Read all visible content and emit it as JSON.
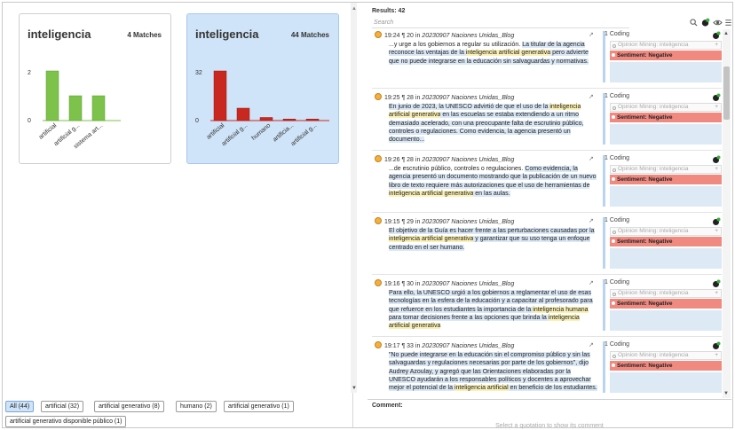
{
  "charts": [
    {
      "title": "inteligencia",
      "matches": "4 Matches",
      "selected": false,
      "color": "#7dc24b",
      "edge": "#5a9e32",
      "yticks": [
        "2",
        "0"
      ],
      "chart_data": {
        "type": "bar",
        "categories": [
          "artificial",
          "artificial g...",
          "sistema art..."
        ],
        "values": [
          2,
          1,
          1
        ],
        "ylim": [
          0,
          2
        ]
      }
    },
    {
      "title": "inteligencia",
      "matches": "44 Matches",
      "selected": true,
      "color": "#c8281f",
      "edge": "#9c1a13",
      "yticks": [
        "32",
        "0"
      ],
      "chart_data": {
        "type": "bar",
        "categories": [
          "artificial",
          "artificial g...",
          "humano",
          "artificia...",
          "artificial g..."
        ],
        "values": [
          32,
          8,
          2,
          1,
          1
        ],
        "ylim": [
          0,
          32
        ]
      }
    }
  ],
  "filters": [
    "All (44)",
    "artificial (32)",
    "artificial generativo (8)",
    "humano (2)",
    "artificial  generativo (1)",
    "artificial generativo disponible público (1)"
  ],
  "results": {
    "label": "Results: 42",
    "search_placeholder": "Search"
  },
  "items": [
    {
      "time": "19:24",
      "pilcrow": "¶ 20 in",
      "doc": "20230907 Naciones Unidas_Blog",
      "segments": [
        [
          "...y urge a los gobiernos a regular su utilización. ",
          ""
        ],
        [
          "La titular de la agencia reconoce las ventajas de la ",
          "hl2"
        ],
        [
          "inteligencia artificial generativa",
          "hl"
        ],
        [
          " pero advierte que no puede integrarse en la educación sin salvaguardas y normativas.",
          "hl2"
        ]
      ],
      "coding": "1 Coding",
      "code1": "Opinion Mining: inteligencia",
      "code2": "Sentiment: Negative"
    },
    {
      "time": "19:25",
      "pilcrow": "¶ 28 in",
      "doc": "20230907 Naciones Unidas_Blog",
      "segments": [
        [
          "En junio de 2023, la UNESCO advirtió de que el uso de la ",
          "hl2"
        ],
        [
          "inteligencia artificial generativa",
          "hl"
        ],
        [
          " en las escuelas se estaba extendiendo a un ritmo demasiado acelerado, con una preocupante falta de escrutinio público, controles o regulaciones. Como evidencia, la agencia presentó un documento...",
          "hl2"
        ]
      ],
      "coding": "1 Coding",
      "code1": "Opinion Mining: inteligencia",
      "code2": "Sentiment: Negative"
    },
    {
      "time": "19:26",
      "pilcrow": "¶ 28 in",
      "doc": "20230907 Naciones Unidas_Blog",
      "segments": [
        [
          "...de escrutinio público, controles o regulaciones. ",
          ""
        ],
        [
          "Como evidencia, la agencia presentó un documento mostrando que la publicación de un nuevo libro de texto requiere más autorizaciones que el uso de herramientas de ",
          "hl2"
        ],
        [
          "inteligencia artificial generativa",
          "hl"
        ],
        [
          " en las aulas.",
          "hl2"
        ]
      ],
      "coding": "1 Coding",
      "code1": "Opinion Mining: inteligencia",
      "code2": "Sentiment: Negative"
    },
    {
      "time": "19:15",
      "pilcrow": "¶ 29 in",
      "doc": "20230907 Naciones Unidas_Blog",
      "segments": [
        [
          "El objetivo de la Guía es hacer frente a las perturbaciones causadas por la ",
          "hl2"
        ],
        [
          "inteligencia artificial generativa",
          "hl"
        ],
        [
          " y garantizar que su uso tenga un enfoque centrado en el ser humano.",
          "hl2"
        ]
      ],
      "coding": "1 Coding",
      "code1": "Opinion Mining: inteligencia",
      "code2": "Sentiment: Negative"
    },
    {
      "time": "19:16",
      "pilcrow": "¶ 30 in",
      "doc": "20230907 Naciones Unidas_Blog",
      "segments": [
        [
          "Para ello, la UNESCO urgió a los gobiernos a reglamentar el uso de esas tecnologías en la esfera de la educación y a capacitar al profesorado para que refuerce en los estudiantes la importancia de la ",
          "hl2"
        ],
        [
          "inteligencia humana",
          "hl"
        ],
        [
          " para tomar decisiones frente a las opciones que brinda la ",
          "hl2"
        ],
        [
          "inteligencia artificial generativa",
          "hl"
        ]
      ],
      "coding": "1 Coding",
      "code1": "Opinion Mining: inteligencia",
      "code2": "Sentiment: Negative"
    },
    {
      "time": "19:17",
      "pilcrow": "¶ 33 in",
      "doc": "20230907 Naciones Unidas_Blog",
      "segments": [
        [
          "\"No puede integrarse en la educación sin el compromiso público y sin las salvaguardas y regulaciones necesarias por parte de los gobiernos\", dijo Audrey Azoulay, y agregó que las Orientaciones elaboradas por la UNESCO ayudarán a los responsables políticos y docentes a aprovechar mejor el potencial de la ",
          "hl2"
        ],
        [
          "inteligencia artificial",
          "hl"
        ],
        [
          " en beneficio de los estudiantes.",
          "hl2"
        ]
      ],
      "coding": "1 Coding",
      "code1": "Opinion Mining: inteligencia",
      "code2": "Sentiment: Negative"
    }
  ],
  "comment": {
    "label": "Comment:",
    "placeholder": "Select a quotation to show its comment"
  },
  "icons": {
    "search": "search-icon",
    "filter": "code-filter-icon",
    "eye": "eye-icon",
    "menu": "menu-icon",
    "quote": "quotation-icon",
    "expand": "expand-arrow-icon",
    "add_code": "add-code-icon"
  }
}
